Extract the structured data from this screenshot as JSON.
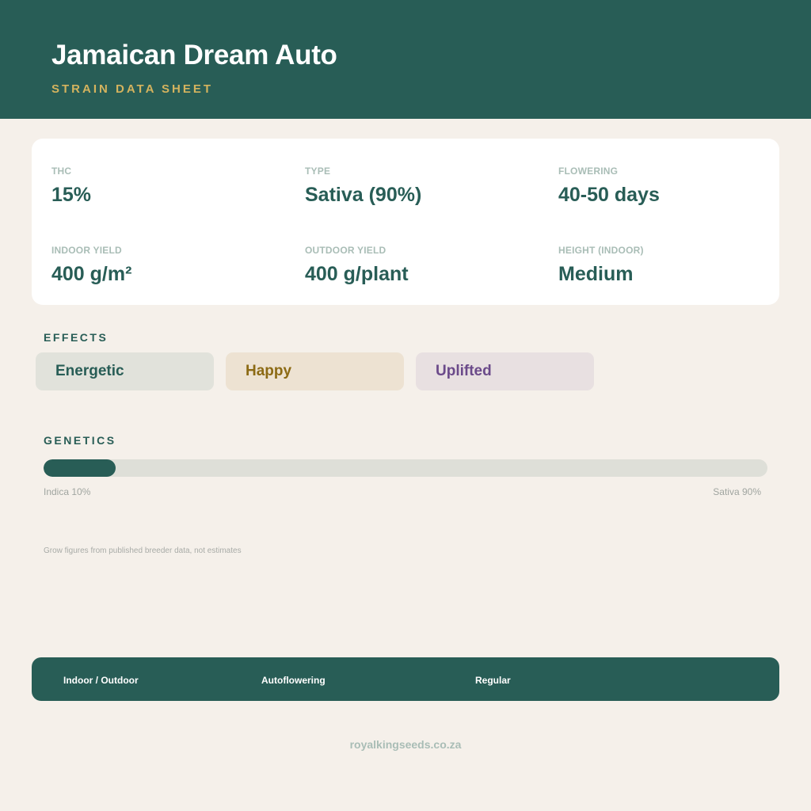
{
  "header": {
    "title": "Jamaican Dream Auto",
    "subtitle": "STRAIN DATA SHEET"
  },
  "stats": [
    {
      "label": "THC",
      "value": "15%"
    },
    {
      "label": "TYPE",
      "value": "Sativa (90%)"
    },
    {
      "label": "FLOWERING",
      "value": "40-50 days"
    },
    {
      "label": "INDOOR YIELD",
      "value": "400 g/m²"
    },
    {
      "label": "OUTDOOR YIELD",
      "value": "400 g/plant"
    },
    {
      "label": "HEIGHT (INDOOR)",
      "value": "Medium"
    }
  ],
  "effects": {
    "title": "EFFECTS",
    "items": [
      {
        "label": "Energetic",
        "bg": "#e1e2db",
        "fg": "#285d56"
      },
      {
        "label": "Happy",
        "bg": "#ede2d2",
        "fg": "#8c6a14"
      },
      {
        "label": "Uplifted",
        "bg": "#e8e0e1",
        "fg": "#6b4a8a"
      }
    ]
  },
  "genetics": {
    "title": "GENETICS",
    "indica_label": "Indica 10%",
    "sativa_label": "Sativa 90%",
    "indica_fraction": 0.1
  },
  "note": "Grow figures from published breeder data, not estimates",
  "footer": {
    "tags": [
      "Indoor / Outdoor",
      "Autoflowering",
      "Regular"
    ]
  },
  "site": "royalkingseeds.co.za",
  "colors": {
    "primary": "#285d56",
    "accent": "#d4b35e",
    "background": "#f5f0ea"
  }
}
